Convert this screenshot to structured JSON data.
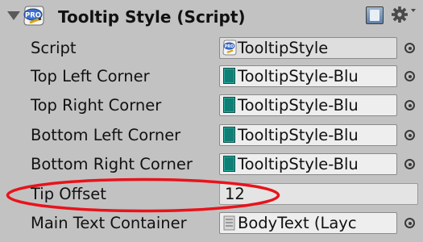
{
  "component": {
    "title": "Tooltip Style (Script)",
    "icons": {
      "fold": "foldout-arrow-icon",
      "script": "script-icon",
      "help": "help-book-icon",
      "settings": "gear-icon",
      "object_picker": "object-picker-icon",
      "texture": "texture-icon",
      "layout": "layout-icon"
    }
  },
  "fields": {
    "script": {
      "label": "Script",
      "value": "TooltipStyle"
    },
    "top_left_corner": {
      "label": "Top Left Corner",
      "value": "TooltipStyle-Blu"
    },
    "top_right_corner": {
      "label": "Top Right Corner",
      "value": "TooltipStyle-Blu"
    },
    "bottom_left_corner": {
      "label": "Bottom Left Corner",
      "value": "TooltipStyle-Blu"
    },
    "bottom_right_corner": {
      "label": "Bottom Right Corner",
      "value": "TooltipStyle-Blu"
    },
    "tip_offset": {
      "label": "Tip Offset",
      "value": "12"
    },
    "main_text_container": {
      "label": "Main Text Container",
      "value": "BodyText (Layc"
    }
  },
  "colors": {
    "panel_background": "#c2c2c2",
    "texture_teal": "#0f7f75",
    "annotation_red": "#e8131b"
  }
}
